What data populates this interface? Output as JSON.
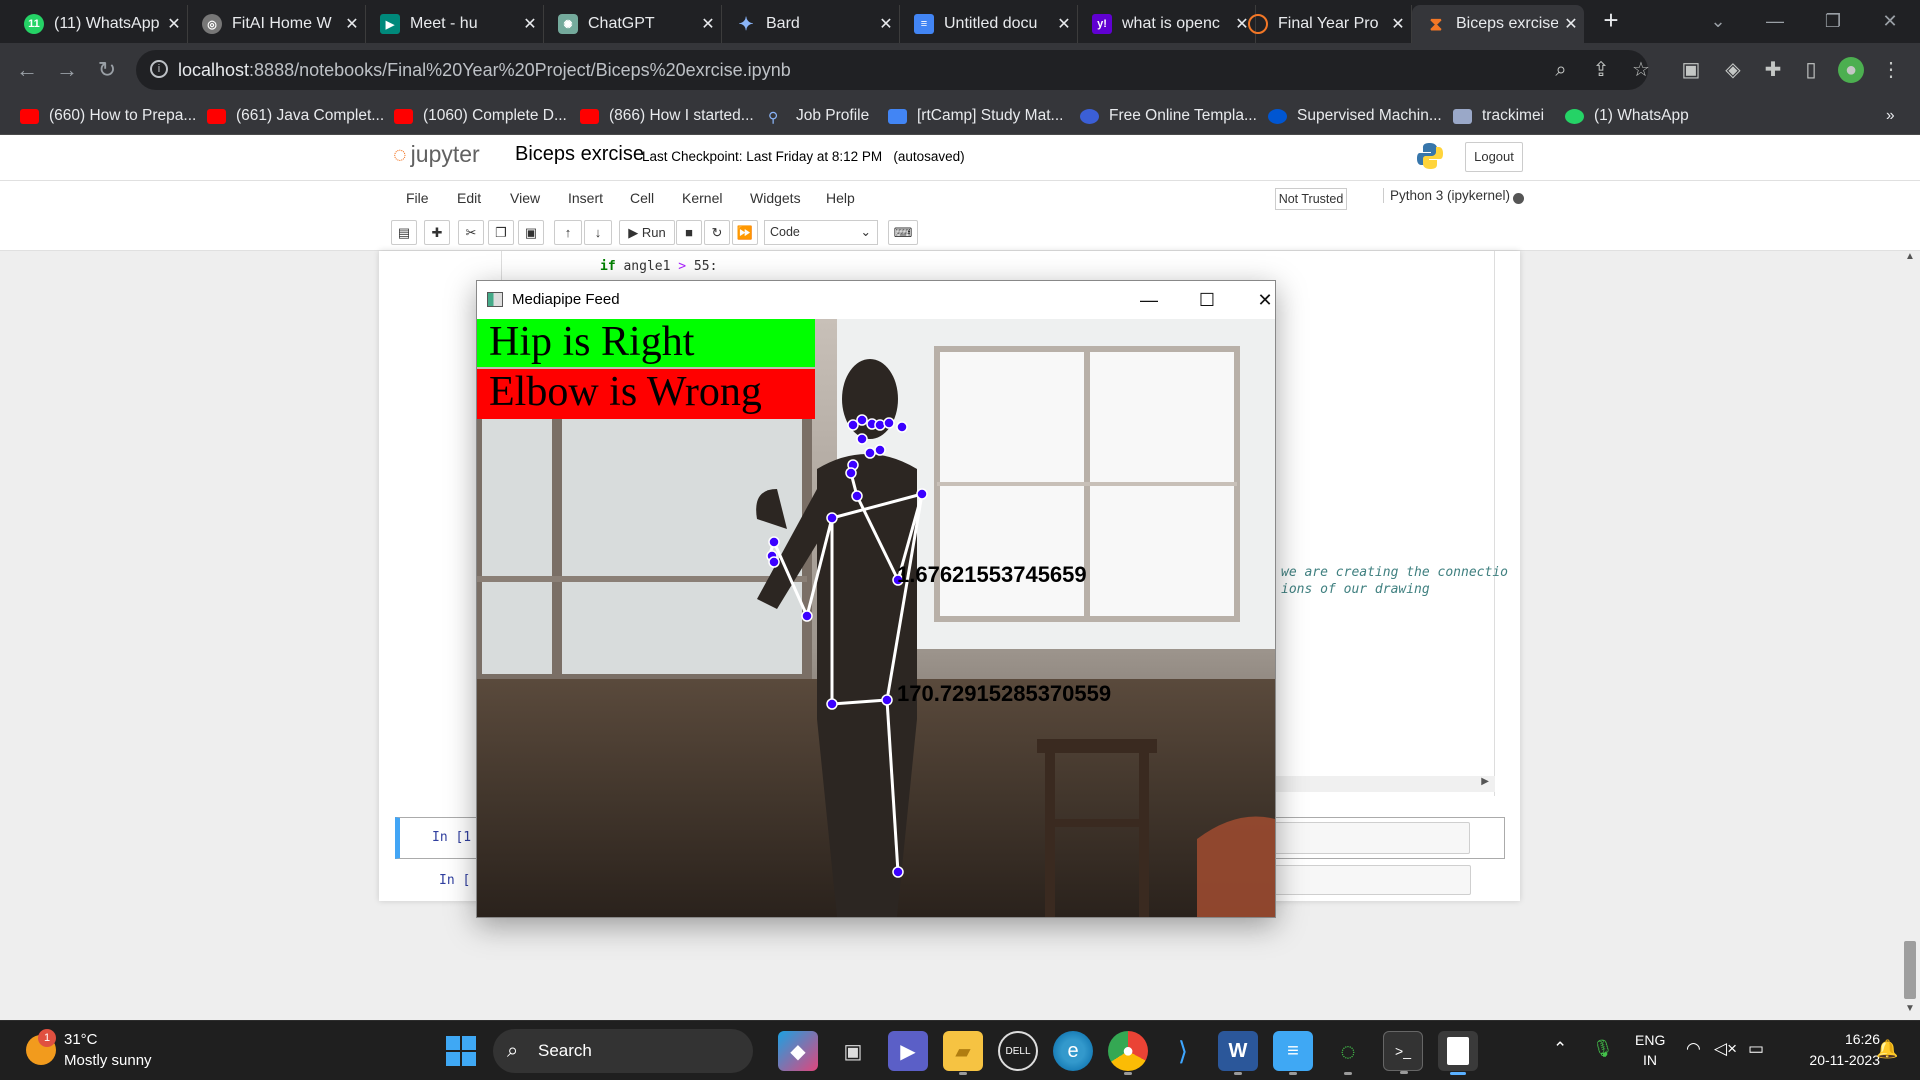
{
  "tabs": [
    {
      "title": "(11) WhatsApp",
      "favicon": "whatsapp-icon",
      "color": "#25d366",
      "badge": "11"
    },
    {
      "title": "FitAI Home W",
      "favicon": "globe-icon",
      "color": "#777777",
      "badge": ""
    },
    {
      "title": "Meet - hu",
      "favicon": "meet-icon",
      "color": "#00897b",
      "badge": ""
    },
    {
      "title": "ChatGPT",
      "favicon": "chatgpt-icon",
      "color": "#74aa9c",
      "badge": ""
    },
    {
      "title": "Bard",
      "favicon": "bard-icon",
      "color": "#4285f4",
      "badge": ""
    },
    {
      "title": "Untitled docu",
      "favicon": "docs-icon",
      "color": "#4285f4",
      "badge": ""
    },
    {
      "title": "what is openc",
      "favicon": "yahoo-icon",
      "color": "#6001d2",
      "badge": "y!"
    },
    {
      "title": "Final Year Pro",
      "favicon": "jupyter-icon",
      "color": "#f37726",
      "badge": ""
    },
    {
      "title": "Biceps exrcise",
      "favicon": "hourglass-icon",
      "color": "#f37726",
      "badge": ""
    }
  ],
  "address": {
    "host": "localhost",
    "path": ":8888/notebooks/Final%20Year%20Project/Biceps%20exrcise.ipynb"
  },
  "bookmarks": [
    {
      "label": "(660) How to Prepa...",
      "icon": "youtube-icon"
    },
    {
      "label": "(661) Java Complet...",
      "icon": "youtube-icon"
    },
    {
      "label": "(1060) Complete D...",
      "icon": "youtube-icon"
    },
    {
      "label": "(866) How I started...",
      "icon": "youtube-icon"
    },
    {
      "label": "Job Profile",
      "icon": "link-icon"
    },
    {
      "label": "[rtCamp] Study Mat...",
      "icon": "docs-icon"
    },
    {
      "label": "Free Online Templa...",
      "icon": "globe-icon"
    },
    {
      "label": "Supervised Machin...",
      "icon": "coursera-icon"
    },
    {
      "label": "trackimei",
      "icon": "site-icon"
    },
    {
      "label": "(1) WhatsApp",
      "icon": "whatsapp-icon"
    }
  ],
  "jupyter": {
    "logo_text": "jupyter",
    "notebook_title": "Biceps exrcise",
    "checkpoint": "Last Checkpoint: Last Friday at 8:12 PM",
    "autosaved": "(autosaved)",
    "logout": "Logout",
    "menus": [
      "File",
      "Edit",
      "View",
      "Insert",
      "Cell",
      "Kernel",
      "Widgets",
      "Help"
    ],
    "not_trusted": "Not Trusted",
    "kernel": "Python 3 (ipykernel)",
    "run_label": "Run",
    "cell_type": "Code",
    "code_line_kw": "if",
    "code_line_rest": " angle1 ",
    "code_line_op": ">",
    "code_line_num": " 55:",
    "comment_line1": "we are creating the connectio",
    "comment_line2": "ions of our drawing",
    "prompt1": "In [1",
    "prompt2": "In ["
  },
  "mediapipe": {
    "window_title": "Mediapipe Feed",
    "hip_status": "Hip is Right",
    "elbow_status": "Elbow is Wrong",
    "hip_color": "#00ff00",
    "elbow_color": "#ff0000",
    "angle_upper": "1.67621553745659",
    "angle_lower": "170.72915285370559"
  },
  "taskbar": {
    "temperature": "31°C",
    "weather": "Mostly sunny",
    "weather_badge": "1",
    "search": "Search",
    "lang_top": "ENG",
    "lang_bottom": "IN",
    "time": "16:26",
    "date": "20-11-2023"
  }
}
